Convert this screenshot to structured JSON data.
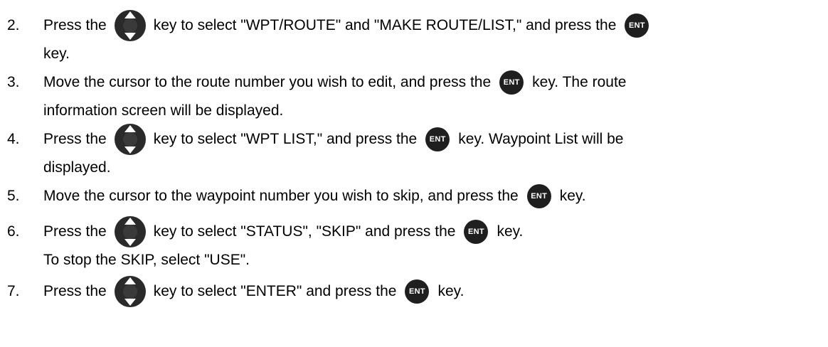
{
  "keys": {
    "ent_label": "ENT"
  },
  "steps": [
    {
      "number": "2.",
      "line1_a": "Press the",
      "line1_b": "key to select \"WPT/ROUTE\" and \"MAKE ROUTE/LIST,\" and press the",
      "line2": "key."
    },
    {
      "number": "3.",
      "line1_a": "Move the cursor to the route number you wish to edit, and press the",
      "line1_b": "key. The route",
      "line2": "information screen will be displayed."
    },
    {
      "number": "4.",
      "line1_a": "Press the",
      "line1_b": "key to select \"WPT LIST,\" and press the",
      "line1_c": "key. Waypoint List will be",
      "line2": "displayed."
    },
    {
      "number": "5.",
      "line1_a": "Move the cursor to the waypoint number you wish to skip, and press the",
      "line1_b": "key."
    },
    {
      "number": "6.",
      "line1_a": "Press the",
      "line1_b": "key to select \"STATUS\", \"SKIP\" and press the",
      "line1_c": "key.",
      "line2": "To stop the SKIP, select \"USE\"."
    },
    {
      "number": "7.",
      "line1_a": "Press the",
      "line1_b": "key to select \"ENTER\" and press the",
      "line1_c": "key."
    }
  ]
}
